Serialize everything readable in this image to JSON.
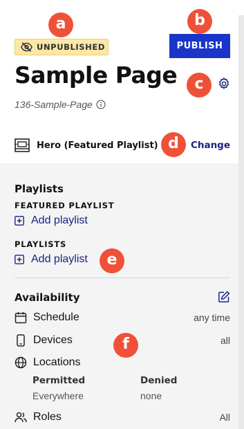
{
  "header": {
    "status_badge": "UNPUBLISHED",
    "publish_label": "PUBLISH",
    "page_title": "Sample Page",
    "slug": "136-Sample-Page"
  },
  "template": {
    "name": "Hero (Featured Playlist)",
    "change_label": "Change"
  },
  "playlists": {
    "title": "Playlists",
    "featured_caption": "FEATURED PLAYLIST",
    "featured_add_label": "Add playlist",
    "playlists_caption": "PLAYLISTS",
    "playlists_add_label": "Add playlist"
  },
  "availability": {
    "title": "Availability",
    "schedule_label": "Schedule",
    "schedule_value": "any time",
    "devices_label": "Devices",
    "devices_value": "all",
    "locations_label": "Locations",
    "permitted_header": "Permitted",
    "permitted_value": "Everywhere",
    "denied_header": "Denied",
    "denied_value": "none",
    "roles_label": "Roles",
    "roles_value": "All"
  },
  "markers": [
    "a",
    "b",
    "c",
    "d",
    "e",
    "f"
  ],
  "colors": {
    "primary": "#1a35c8",
    "link": "#1a237e",
    "badge_bg": "#fbe8a8",
    "marker": "#ef5138",
    "panel_bg": "#f4f4f5"
  },
  "icons": {
    "badge": "eye-off-icon",
    "settings": "gear-icon",
    "slug_info": "info-icon",
    "template": "layout-icon",
    "add": "plus-square-icon",
    "edit": "edit-icon",
    "schedule": "calendar-icon",
    "devices": "device-icon",
    "locations": "globe-icon",
    "roles": "users-icon"
  }
}
